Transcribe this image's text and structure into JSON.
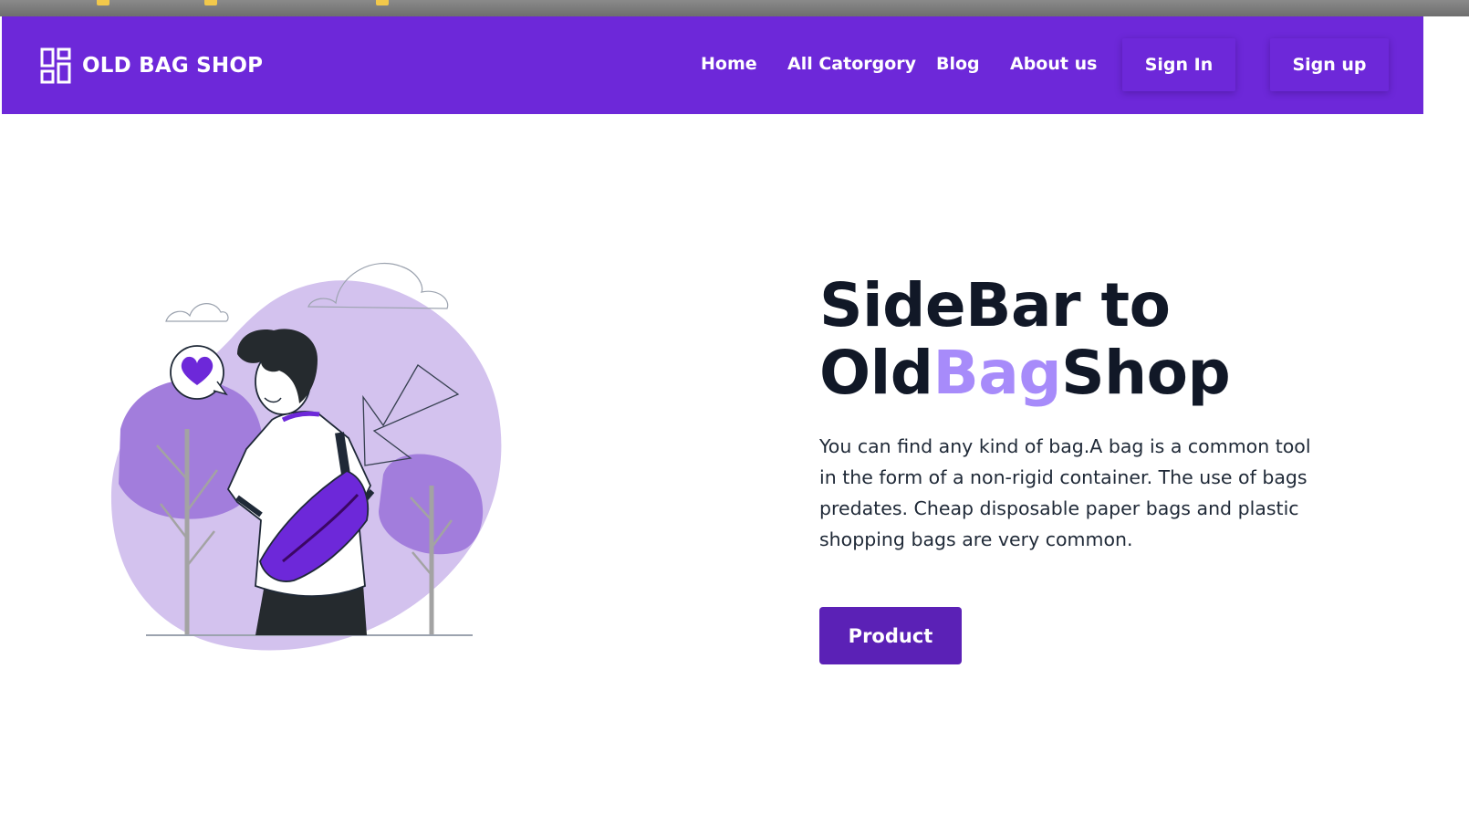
{
  "nav": {
    "brand": "OLD BAG SHOP",
    "links": [
      "Home",
      "All Catorgory",
      "Blog",
      "About us"
    ],
    "sign_in": "Sign In",
    "sign_up": "Sign up"
  },
  "hero": {
    "title_line1": "SideBar to",
    "title_prefix": "Old",
    "title_accent": "Bag",
    "title_suffix": "Shop",
    "description": "You can find any kind of bag.A bag is a common tool in the form of a non-rigid container. The use of bags predates. Cheap disposable paper bags and plastic shopping bags are very common.",
    "cta": "Product"
  },
  "colors": {
    "nav_bg": "#6d28d9",
    "accent": "#a78bfa",
    "cta_bg": "#5b21b6",
    "heading": "#111827"
  },
  "icons": {
    "brand": "dashboard-grid-icon"
  }
}
